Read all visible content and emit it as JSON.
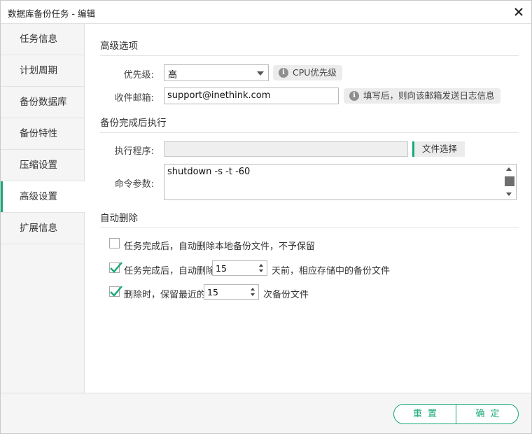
{
  "window": {
    "title": "数据库备份任务 - 编辑"
  },
  "sidebar": {
    "items": [
      {
        "label": "任务信息",
        "active": false
      },
      {
        "label": "计划周期",
        "active": false
      },
      {
        "label": "备份数据库",
        "active": false
      },
      {
        "label": "备份特性",
        "active": false
      },
      {
        "label": "压缩设置",
        "active": false
      },
      {
        "label": "高级设置",
        "active": true
      },
      {
        "label": "扩展信息",
        "active": false
      }
    ]
  },
  "advanced": {
    "section_title": "高级选项",
    "priority_label": "优先级:",
    "priority_value": "高",
    "priority_hint": "CPU优先级",
    "email_label": "收件邮箱:",
    "email_value": "support@inethink.com",
    "email_hint": "填写后，则向该邮箱发送日志信息"
  },
  "post_exec": {
    "section_title": "备份完成后执行",
    "program_label": "执行程序:",
    "program_value": "",
    "file_button": "文件选择",
    "args_label": "命令参数:",
    "args_value": "shutdown -s -t -60"
  },
  "auto_delete": {
    "section_title": "自动删除",
    "option1": {
      "label": "任务完成后，自动删除本地备份文件，不予保留",
      "checked": false
    },
    "option2": {
      "label_before": "任务完成后，自动删除",
      "value": "15",
      "label_after": "天前，相应存储中的备份文件",
      "checked": true
    },
    "option3": {
      "label_before": "删除时，保留最近的",
      "value": "15",
      "label_after": "次备份文件",
      "checked": true
    }
  },
  "footer": {
    "reset_label": "重置",
    "confirm_label": "确定"
  },
  "colors": {
    "accent": "#1aa87a",
    "sidebar_bg": "#f5f5f5",
    "hint_bg": "#ececec"
  }
}
